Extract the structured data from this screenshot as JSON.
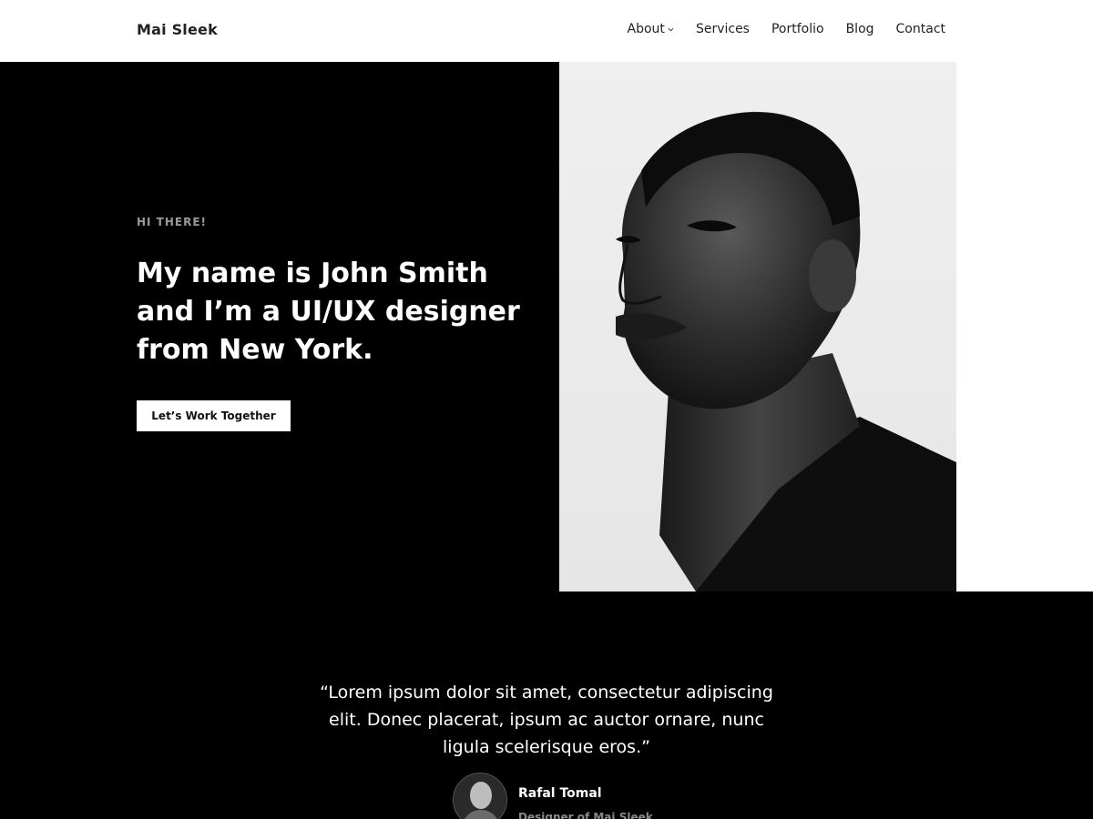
{
  "header": {
    "logo": "Mai Sleek",
    "nav": [
      {
        "label": "About",
        "has_dropdown": true
      },
      {
        "label": "Services"
      },
      {
        "label": "Portfolio"
      },
      {
        "label": "Blog"
      },
      {
        "label": "Contact"
      }
    ]
  },
  "hero": {
    "eyebrow": "HI THERE!",
    "headline": "My name is John Smith and I’m a UI/UX designer from New York.",
    "cta_label": "Let’s Work Together",
    "photo_icon": "portrait-photo",
    "colors": {
      "background": "#000000",
      "text": "#ffffff",
      "eyebrow": "#9a9a9a"
    }
  },
  "testimonial": {
    "quote": "“Lorem ipsum dolor sit amet, consectetur adipiscing elit. Donec placerat, ipsum ac auctor ornare, nunc ligula scelerisque eros.”",
    "author_name": "Rafal Tomal",
    "author_role": "Designer of Mai Sleek",
    "avatar_icon": "avatar-photo"
  }
}
